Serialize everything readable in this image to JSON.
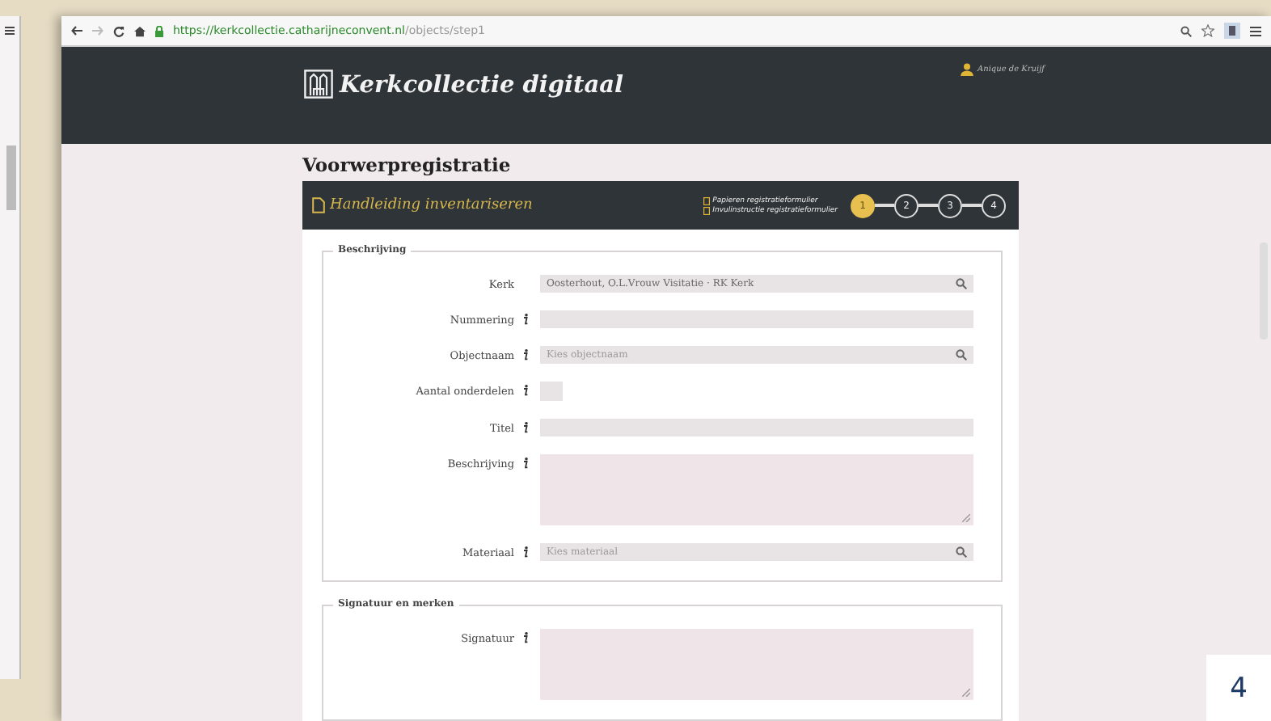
{
  "browser": {
    "url_host": "https://kerkcollectie.catharijneconvent.nl",
    "url_path": "/objects/step1"
  },
  "header": {
    "site_title": "Kerkcollectie digitaal",
    "user": "Anique de Kruijf"
  },
  "page_title": "Voorwerpregistratie",
  "toolbar": {
    "manual_link": "Handleiding inventariseren",
    "form_links": [
      "Papieren registratieformulier",
      "Invulinstructie registratieformulier"
    ],
    "steps": [
      {
        "label": "1",
        "selected": true
      },
      {
        "label": "2",
        "selected": false
      },
      {
        "label": "3",
        "selected": false
      },
      {
        "label": "4",
        "selected": false
      }
    ]
  },
  "fieldsets": [
    {
      "legend": "Beschrijving",
      "fields": [
        {
          "label": "Kerk",
          "info": false,
          "kind": "lookup",
          "value": "Oosterhout, O.L.Vrouw Visitatie · RK Kerk"
        },
        {
          "label": "Nummering",
          "info": true,
          "kind": "text"
        },
        {
          "label": "Objectnaam",
          "info": true,
          "kind": "lookup",
          "placeholder": "Kies objectnaam"
        },
        {
          "label": "Aantal onderdelen",
          "info": true,
          "kind": "number"
        },
        {
          "label": "Titel",
          "info": true,
          "kind": "text"
        },
        {
          "label": "Beschrijving",
          "info": true,
          "kind": "textarea"
        },
        {
          "label": "Materiaal",
          "info": true,
          "kind": "lookup",
          "placeholder": "Kies materiaal"
        }
      ]
    },
    {
      "legend": "Signatuur en merken",
      "fields": [
        {
          "label": "Signatuur",
          "info": true,
          "kind": "textarea"
        }
      ]
    }
  ],
  "page_number": "4"
}
